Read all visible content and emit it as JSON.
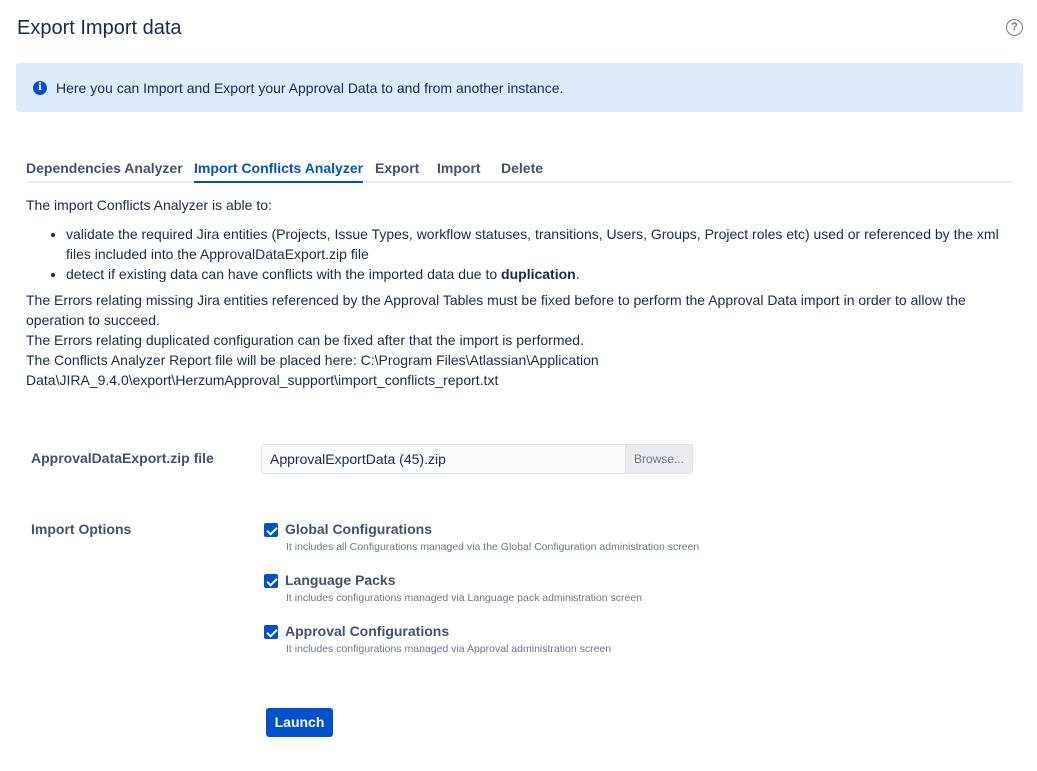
{
  "page": {
    "title": "Export Import data",
    "help_icon": "?"
  },
  "info": {
    "icon": "i",
    "text": "Here you can Import and Export your Approval Data to and from another instance."
  },
  "tabs": [
    {
      "label": "Dependencies Analyzer",
      "active": false
    },
    {
      "label": "Import Conflicts Analyzer",
      "active": true
    },
    {
      "label": "Export",
      "active": false
    },
    {
      "label": "Import",
      "active": false
    },
    {
      "label": "Delete",
      "active": false
    }
  ],
  "description": {
    "intro": "The import Conflicts Analyzer is able to:",
    "bullet_1": "validate the required Jira entities (Projects, Issue Types, workflow statuses, transitions, Users, Groups, Project roles etc) used or referenced by the xml files included into the ApprovalDataExport.zip file",
    "bullet_2_prefix": "detect if existing data can have conflicts with the imported data due to ",
    "bullet_2_bold": "duplication",
    "bullet_2_suffix": ".",
    "para_1": "The Errors relating missing Jira entities referenced by the Approval Tables must be fixed before to perform the Approval Data import in order to allow the operation to succeed.",
    "para_2": "The Errors relating duplicated configuration can be fixed after that the import is performed.",
    "para_3": "The Conflicts Analyzer Report file will be placed here: C:\\Program Files\\Atlassian\\Application Data\\JIRA_9.4.0\\export\\HerzumApproval_support\\import_conflicts_report.txt"
  },
  "form": {
    "file_label": "ApprovalDataExport.zip file",
    "file_value": "ApprovalExportData (45).zip",
    "browse_label": "Browse...",
    "options_label": "Import Options",
    "options": [
      {
        "label": "Global Configurations",
        "description": "It includes all Configurations managed via the Global Configuration administration screen",
        "checked": true
      },
      {
        "label": "Language Packs",
        "description": "It includes configurations managed via Language pack administration screen",
        "checked": true
      },
      {
        "label": "Approval Configurations",
        "description": "It includes configurations managed via Approval administration screen",
        "checked": true
      }
    ],
    "launch_label": "Launch"
  },
  "colors": {
    "accent": "#0052cc",
    "info_bg": "#deebff",
    "text": "#172b4d",
    "muted": "#6b778c"
  }
}
